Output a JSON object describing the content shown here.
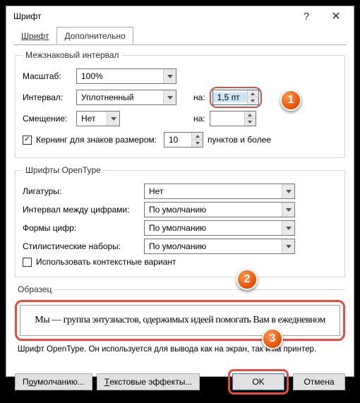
{
  "title": "Шрифт",
  "tabs": {
    "font": "Шрифт",
    "advanced": "Дополнительно"
  },
  "spacing": {
    "legend": "Межзнаковый интервал",
    "scale_label": "Масштаб:",
    "scale_ul": "б",
    "scale_val": "100%",
    "spacing_label": "Интервал:",
    "spacing_ul": "И",
    "spacing_val": "Уплотненный",
    "by1_label": "на:",
    "by1_ul": "а",
    "by1_val": "1,5 пт",
    "position_label": "Смещение:",
    "position_ul": "м",
    "position_val": "Нет",
    "by2_label": "на:",
    "kerning_ul": "К",
    "kerning_label": "ернинг для знаков размером:",
    "kerning_val": "10",
    "kerning_suffix": "пунктов и более"
  },
  "opentype": {
    "legend": "Шрифты OpenType",
    "lig_label": "Лигатуры:",
    "lig_ul": "Л",
    "lig_val": "Нет",
    "numsp_label": "Интервал между цифрами:",
    "numsp_val": "По умолчанию",
    "numform_label": "Формы цифр:",
    "numform_ul": "Ф",
    "numform_val": "По умолчанию",
    "style_label": "тилистические наборы:",
    "style_ul": "С",
    "style_val": "По умолчанию",
    "ctx_ul": "п",
    "ctx_label": "Ис",
    "ctx_label2": "ользовать контекстные вариант"
  },
  "sample": {
    "legend": "Образец",
    "text": "Мы — группа энтузиастов, одержимых идеей помогать Вам в ежедневном",
    "hint": "Шрифт OpenType. Он используется для вывода как на экран, так и на принтер."
  },
  "buttons": {
    "default_ul": "о",
    "default": "П",
    "default2": " умолчанию...",
    "effects_ul": "Т",
    "effects": "екстовые эффекты...",
    "ok": "OK",
    "cancel": "Отмена"
  }
}
